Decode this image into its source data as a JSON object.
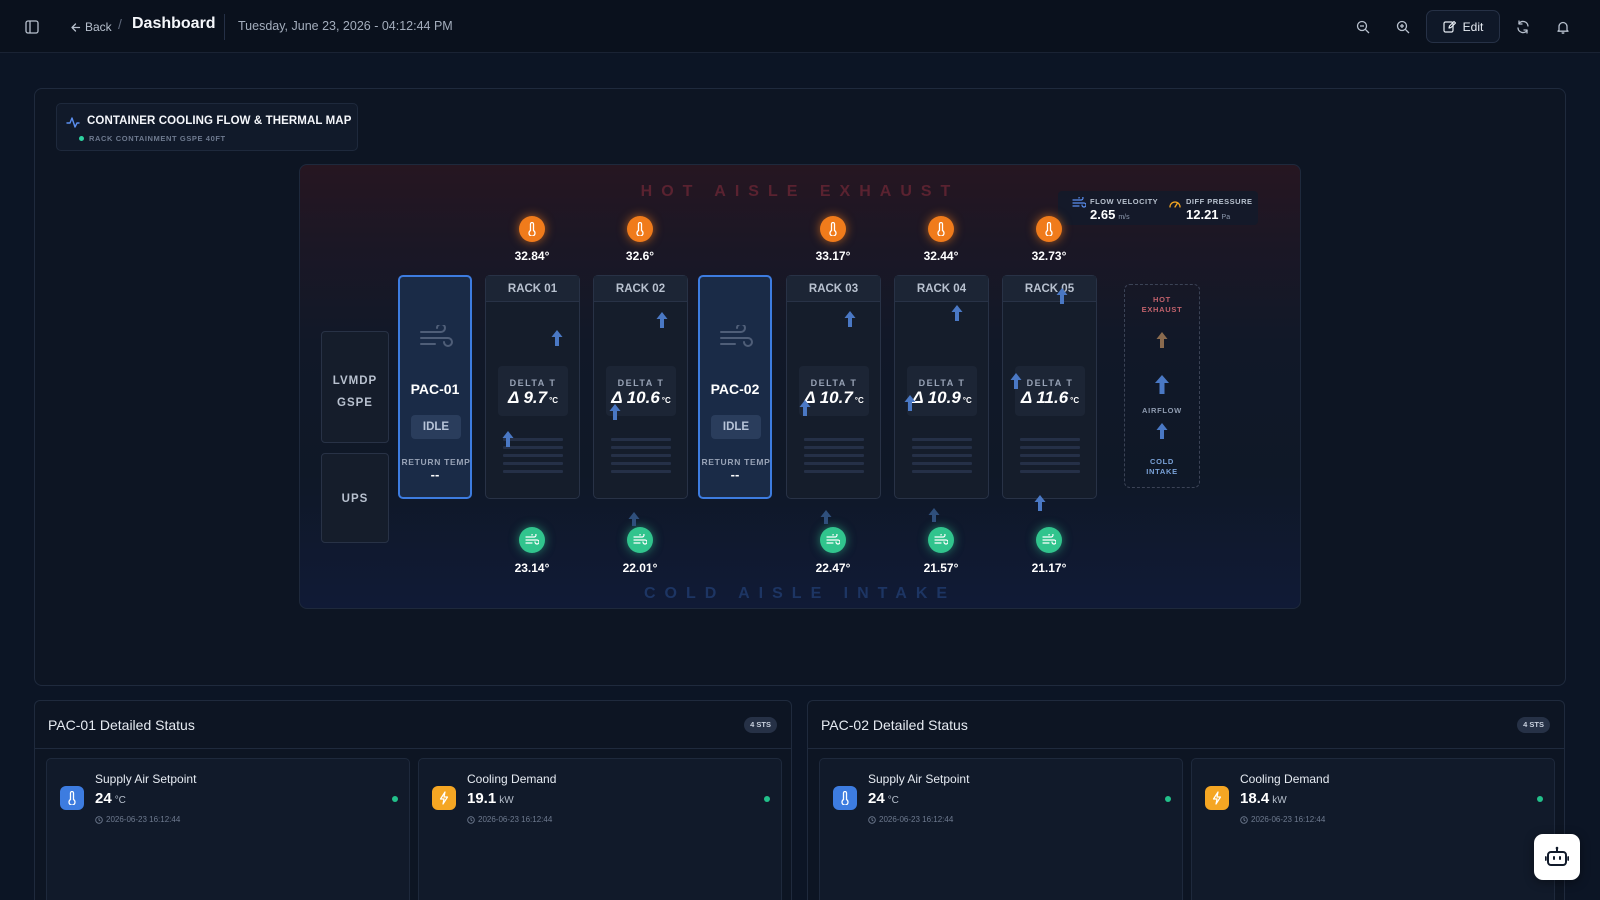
{
  "header": {
    "back_label": "Back",
    "separator": "/",
    "title": "Dashboard",
    "datetime": "Tuesday, June 23, 2026 - 04:12:44 PM",
    "edit_label": "Edit"
  },
  "widget": {
    "title": "CONTAINER COOLING FLOW & THERMAL MAP",
    "subtitle": "RACK CONTAINMENT GSPE 40FT"
  },
  "map": {
    "hot_aisle_label": "HOT AISLE EXHAUST",
    "cold_aisle_label": "COLD AISLE INTAKE",
    "flow_velocity": {
      "label": "FLOW VELOCITY",
      "value": "2.65",
      "unit": "m/s"
    },
    "diff_pressure": {
      "label": "DIFF PRESSURE",
      "value": "12.21",
      "unit": "Pa"
    },
    "side_units": {
      "lvmdp_line1": "LVMDP",
      "lvmdp_line2": "GSPE",
      "ups": "UPS"
    },
    "delta_label": "DELTA T",
    "delta_unit": "°C",
    "pacs": [
      {
        "name": "PAC-01",
        "state": "IDLE",
        "return_label": "RETURN TEMP",
        "return_value": "--"
      },
      {
        "name": "PAC-02",
        "state": "IDLE",
        "return_label": "RETURN TEMP",
        "return_value": "--"
      }
    ],
    "racks": [
      {
        "name": "RACK 01",
        "delta": "Δ 9.7",
        "hot_temp": "32.84°",
        "cold_temp": "23.14°"
      },
      {
        "name": "RACK 02",
        "delta": "Δ 10.6",
        "hot_temp": "32.6°",
        "cold_temp": "22.01°"
      },
      {
        "name": "RACK 03",
        "delta": "Δ 10.7",
        "hot_temp": "33.17°",
        "cold_temp": "22.47°"
      },
      {
        "name": "RACK 04",
        "delta": "Δ 10.9",
        "hot_temp": "32.44°",
        "cold_temp": "21.57°"
      },
      {
        "name": "RACK 05",
        "delta": "Δ 11.6",
        "hot_temp": "32.73°",
        "cold_temp": "21.17°"
      }
    ],
    "legend": {
      "hot_line1": "HOT",
      "hot_line2": "EXHAUST",
      "airflow": "AIRFLOW",
      "cold_line1": "COLD",
      "cold_line2": "INTAKE"
    }
  },
  "details": [
    {
      "title": "PAC-01 Detailed Status",
      "badge": "4 STS",
      "metrics": [
        {
          "label": "Supply Air Setpoint",
          "value": "24",
          "unit": "°C",
          "time": "2026-06-23 16:12:44",
          "icon": "thermometer-icon"
        },
        {
          "label": "Cooling Demand",
          "value": "19.1",
          "unit": "kW",
          "time": "2026-06-23 16:12:44",
          "icon": "lightning-icon"
        }
      ]
    },
    {
      "title": "PAC-02 Detailed Status",
      "badge": "4 STS",
      "metrics": [
        {
          "label": "Supply Air Setpoint",
          "value": "24",
          "unit": "°C",
          "time": "2026-06-23 16:12:44",
          "icon": "thermometer-icon"
        },
        {
          "label": "Cooling Demand",
          "value": "18.4",
          "unit": "kW",
          "time": "2026-06-23 16:12:44",
          "icon": "lightning-icon"
        }
      ]
    }
  ],
  "colors": {
    "background": "#0c1525",
    "accent_blue": "#3d7ce0",
    "hot_orange": "#f07b1b",
    "cold_green": "#31c48d",
    "status_green": "#22c08a"
  }
}
